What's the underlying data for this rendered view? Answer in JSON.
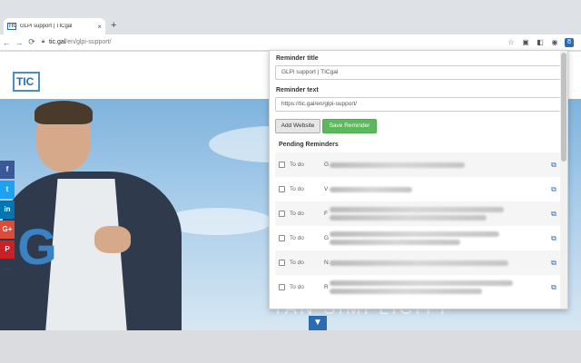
{
  "browser": {
    "tab_title": "GLPi support | TICgal",
    "tab_favicon": "TIC",
    "tab_close": "×",
    "new_tab": "+",
    "url_host": "tic.gal",
    "url_path": "/en/glpi-support/"
  },
  "site": {
    "logo_text": "TIC",
    "hero_text": "TAN SIMPLICITY",
    "emblem": "G"
  },
  "social": [
    "f",
    "t",
    "in",
    "G+",
    "P",
    "⋯"
  ],
  "popup": {
    "reminder_title_label": "Reminder title",
    "reminder_title_value": "GLPi support | TICgal",
    "reminder_text_label": "Reminder text",
    "reminder_text_value": "https://tic.gal/en/glpi-support/",
    "add_website_label": "Add Website",
    "save_reminder_label": "Save Reminder",
    "pending_label": "Pending Reminders",
    "reminders": [
      {
        "status": "To do",
        "initial": "G",
        "lines": [
          1
        ]
      },
      {
        "status": "To do",
        "initial": "V",
        "lines": [
          1
        ]
      },
      {
        "status": "To do",
        "initial": "F",
        "lines": [
          1,
          1
        ]
      },
      {
        "status": "To do",
        "initial": "G",
        "lines": [
          1,
          1
        ]
      },
      {
        "status": "To do",
        "initial": "N",
        "lines": [
          1
        ]
      },
      {
        "status": "To do",
        "initial": "R",
        "lines": [
          1,
          1
        ]
      }
    ]
  },
  "colors": {
    "accent": "#2b6cb0",
    "save_green": "#5cb85c"
  }
}
